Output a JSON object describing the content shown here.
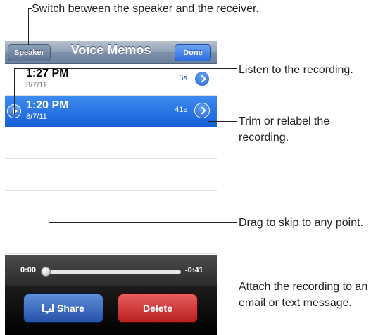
{
  "callouts": {
    "speaker": "Switch between the speaker and the receiver.",
    "listen": "Listen to the recording.",
    "trim_line1": "Trim or relabel the",
    "trim_line2": "recording.",
    "drag": "Drag to skip to any point.",
    "attach_line1": "Attach the recording to an",
    "attach_line2": "email or text message."
  },
  "navbar": {
    "title": "Voice Memos",
    "speaker_label": "Speaker",
    "done_label": "Done"
  },
  "recordings": [
    {
      "time": "1:27 PM",
      "date": "8/7/11",
      "duration": "5s"
    },
    {
      "time": "1:20 PM",
      "date": "8/7/11",
      "duration": "41s"
    }
  ],
  "scrubber": {
    "elapsed": "0:00",
    "remaining": "-0:41",
    "progress": 0
  },
  "toolbar": {
    "share_label": "Share",
    "delete_label": "Delete"
  },
  "colors": {
    "selection": "#1f6ddf",
    "delete": "#c62828",
    "share": "#2f5bb5"
  }
}
